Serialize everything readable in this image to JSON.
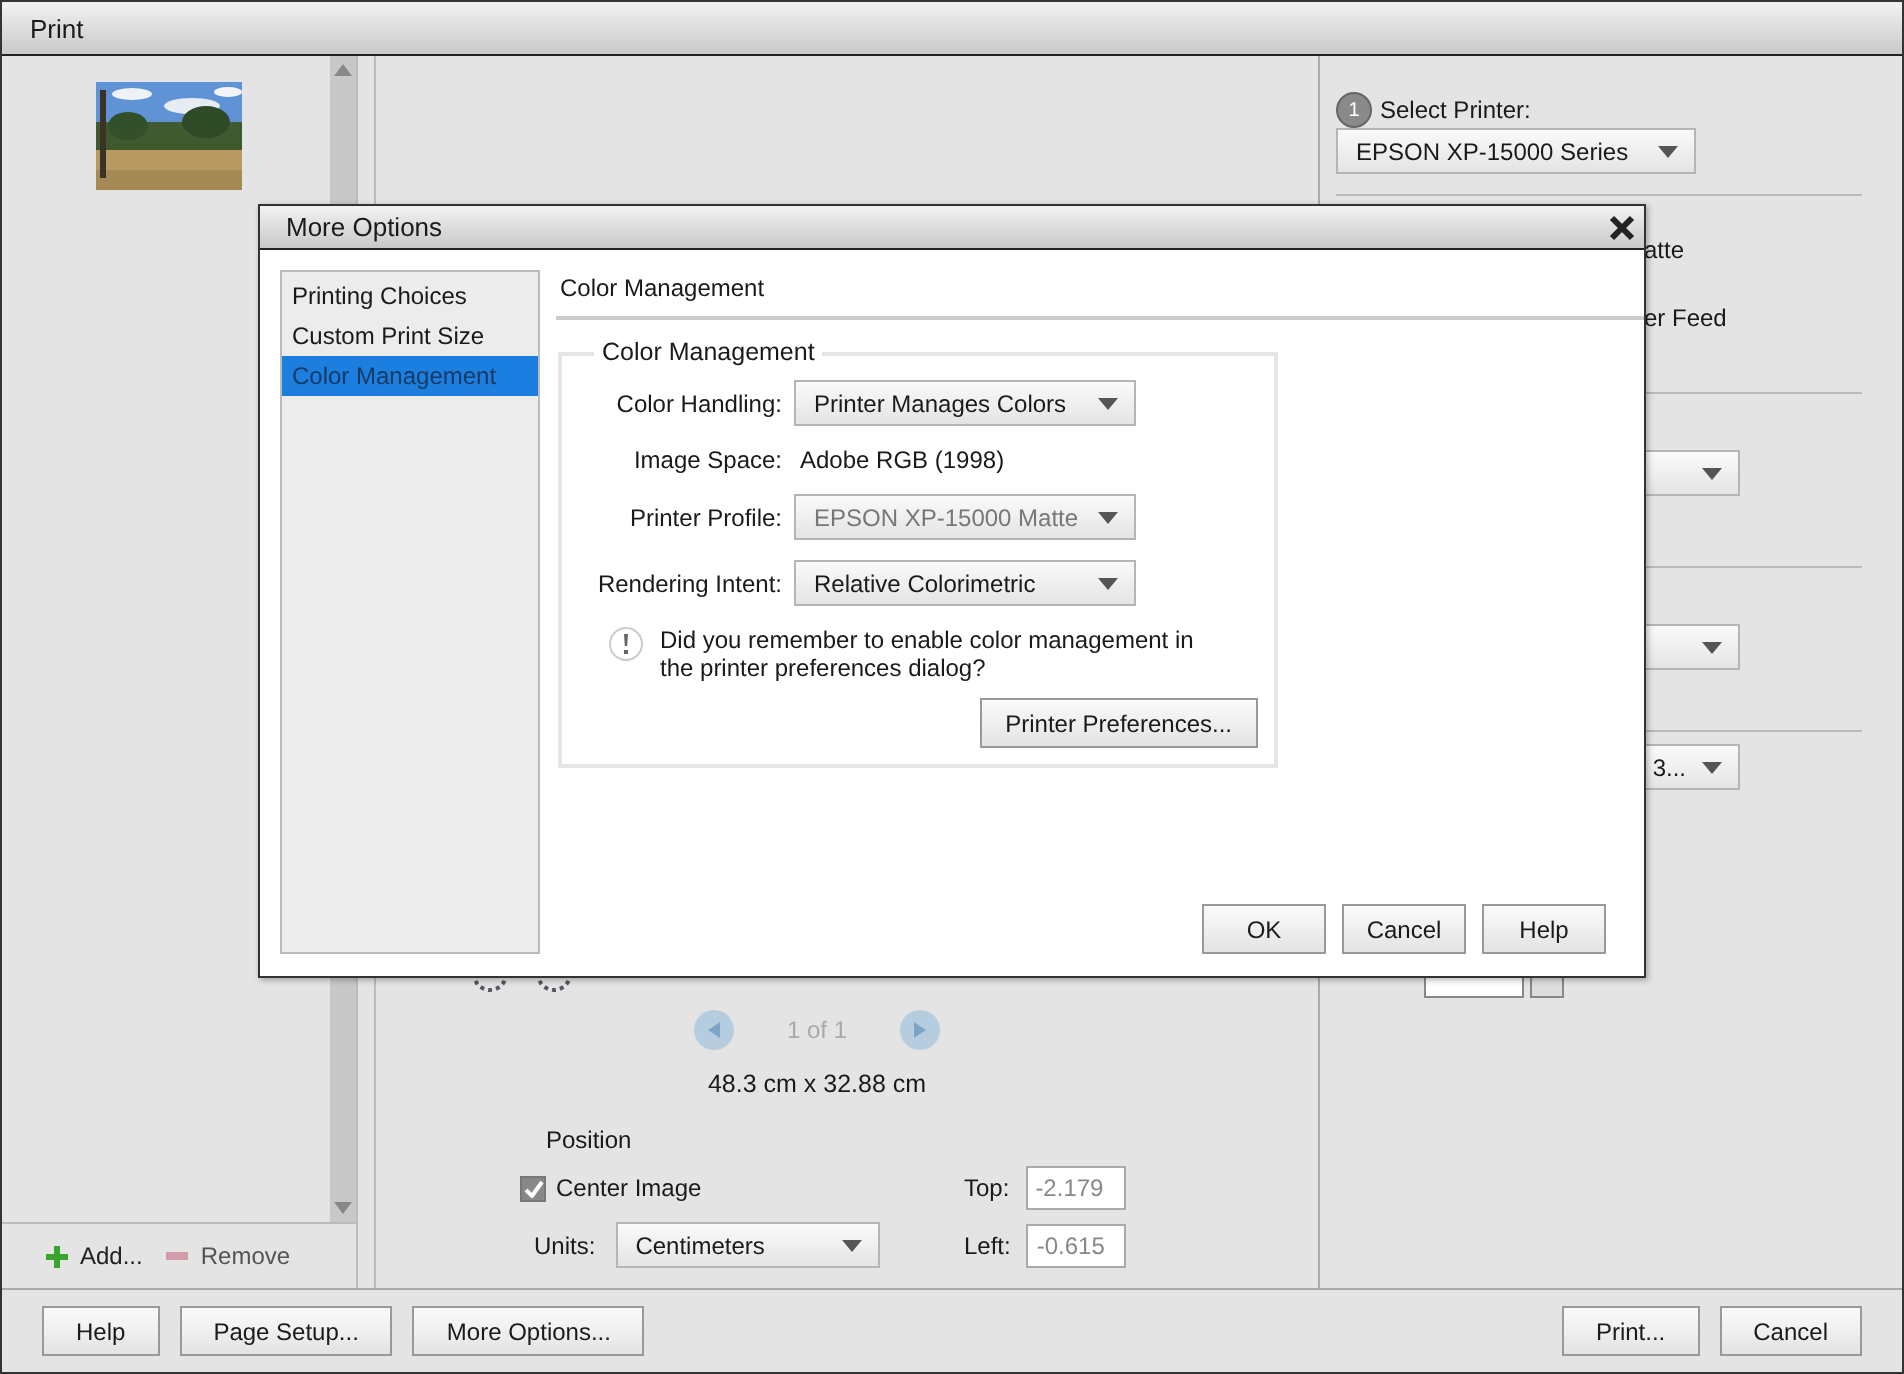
{
  "window": {
    "title": "Print"
  },
  "thumbnails": [
    {
      "kind": "picture"
    }
  ],
  "list_actions": {
    "add": "Add...",
    "remove": "Remove"
  },
  "preview": {
    "pager": {
      "text": "1 of 1",
      "disabled": true
    },
    "size": "48.3 cm x 32.88 cm"
  },
  "position": {
    "title": "Position",
    "center_image": {
      "label": "Center Image",
      "checked": true
    },
    "top_label": "Top:",
    "top": {
      "value": "-2.179",
      "disabled": true
    },
    "units_label": "Units:",
    "units": "Centimeters",
    "left_label": "Left:",
    "left": {
      "value": "-0.615",
      "disabled": true
    }
  },
  "printer_panel": {
    "step": "1",
    "select_printer_label": "Select Printer:",
    "printer": "EPSON XP-15000 Series",
    "partial_texts": [
      "atte",
      "er Feed"
    ],
    "size_dropdown": "3..."
  },
  "bottom_buttons_left": [
    "Help",
    "Page Setup...",
    "More Options..."
  ],
  "bottom_buttons_right": [
    "Print...",
    "Cancel"
  ],
  "dialog": {
    "title": "More Options",
    "categories": [
      {
        "label": "Printing Choices",
        "selected": false
      },
      {
        "label": "Custom Print Size",
        "selected": false
      },
      {
        "label": "Color Management",
        "selected": true
      }
    ],
    "heading": "Color Management",
    "group_title": "Color Management",
    "fields": [
      {
        "label": "Color Handling:",
        "kind": "dropdown",
        "value": "Printer Manages Colors",
        "disabled": false
      },
      {
        "label": "Image Space:",
        "kind": "text",
        "value": "Adobe RGB (1998)"
      },
      {
        "label": "Printer Profile:",
        "kind": "dropdown",
        "value": "EPSON XP-15000 Matte",
        "disabled": true
      },
      {
        "label": "Rendering Intent:",
        "kind": "dropdown",
        "value": "Relative Colorimetric",
        "disabled": false
      }
    ],
    "notice": "Did you remember to enable color management in the printer preferences dialog?",
    "preferences_button": "Printer Preferences...",
    "buttons": [
      "OK",
      "Cancel",
      "Help"
    ]
  }
}
